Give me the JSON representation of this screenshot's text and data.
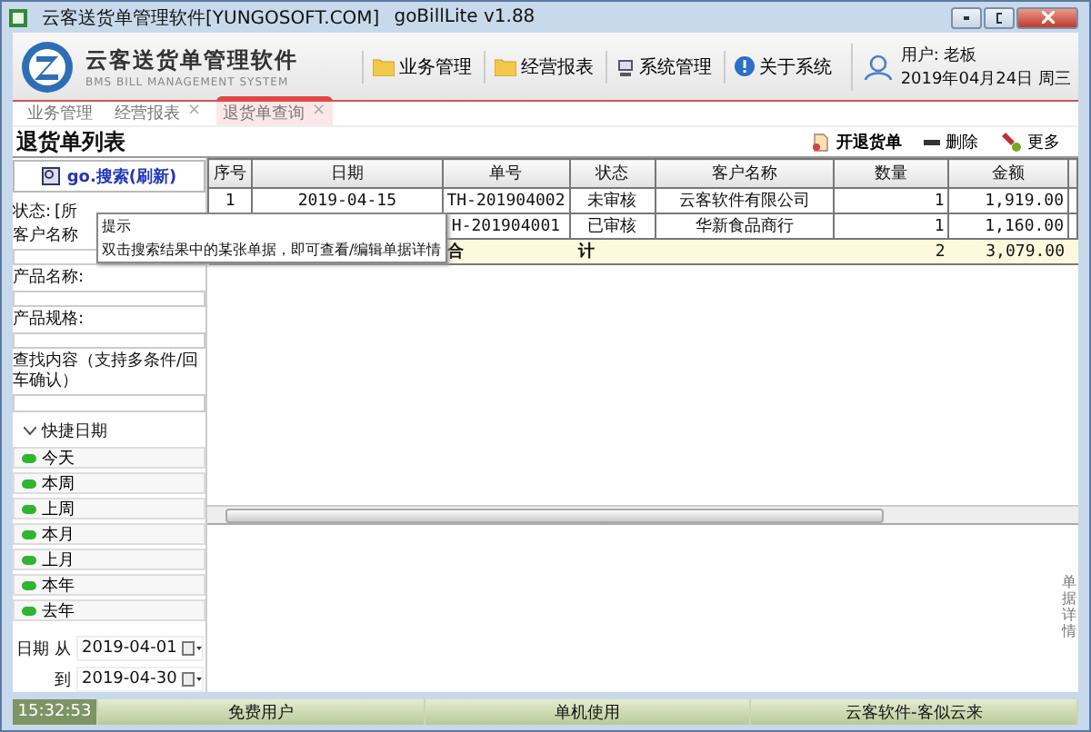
{
  "window": {
    "title": "云客送货单管理软件[YUNGOSOFT.COM]",
    "version": "goBillLite v1.88"
  },
  "header": {
    "app_name": "云客送货单管理软件",
    "subtitle": "BMS BILL MANAGEMENT SYSTEM",
    "menu": [
      {
        "label": "业务管理",
        "kind": "folder"
      },
      {
        "label": "经营报表",
        "kind": "folder"
      },
      {
        "label": "系统管理",
        "kind": "system"
      },
      {
        "label": "关于系统",
        "kind": "help"
      }
    ],
    "user": "用户: 老板",
    "date": "2019年04月24日 周三"
  },
  "tabs": [
    {
      "label": "业务管理",
      "selected": false
    },
    {
      "label": "经营报表",
      "close": "×",
      "selected": false
    },
    {
      "label": "退货单查询",
      "close": "×",
      "selected": true
    }
  ],
  "page_title": "退货单列表",
  "actions": [
    {
      "label": "开退货单",
      "kind": "new"
    },
    {
      "label": "删除",
      "kind": "delete"
    },
    {
      "label": "更多",
      "kind": "more"
    }
  ],
  "search_button": "go.搜索(刷新)",
  "filters": {
    "status_label": "状态:",
    "status_value": "[所",
    "customer_label": "客户名称",
    "product_label": "产品名称:",
    "spec_label": "产品规格:",
    "find_label": "查找内容（支持多条件/回车确认）"
  },
  "quick_dates": {
    "title": "快捷日期",
    "expanded": true,
    "items": [
      "今天",
      "本周",
      "上周",
      "本月",
      "上月",
      "本年",
      "去年"
    ]
  },
  "date_range": {
    "label": "日期 从",
    "from": "2019-04-01",
    "to_label": "到",
    "to": "2019-04-30"
  },
  "table": {
    "columns": [
      "序号",
      "日期",
      "单号",
      "状态",
      "客户名称",
      "数量",
      "金额"
    ],
    "rows": [
      {
        "no": "1",
        "date": "2019-04-15",
        "number": "TH-201904002",
        "status": "未审核",
        "customer": "云客软件有限公司",
        "qty": "1",
        "amount": "1,919.00",
        "selected": false
      },
      {
        "number": "H-201904001",
        "status": "已审核",
        "customer": "华新食品商行",
        "qty": "1",
        "amount": "1,160.00",
        "selected": false
      }
    ],
    "total": {
      "label": "合 计",
      "qty": "2",
      "amount": "3,079.00"
    }
  },
  "tooltip": {
    "title": "提示",
    "text": "双击搜索结果中的某张单据，即可查看/编辑单据详情"
  },
  "detail_tab": "单据详情",
  "status_bar": [
    "15:32:53",
    "免费用户",
    "单机使用",
    "云客软件-客似云来"
  ]
}
